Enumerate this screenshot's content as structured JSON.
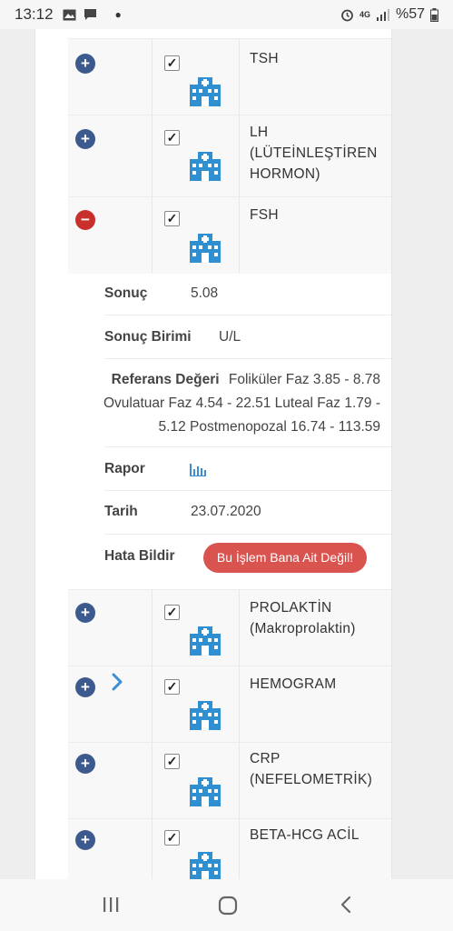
{
  "status_bar": {
    "time": "13:12",
    "battery": "%57",
    "network": "4G"
  },
  "tests": [
    {
      "name": "TSH",
      "expanded": false
    },
    {
      "name": "LH (LÜTEİNLEŞTİREN HORMON)",
      "expanded": false
    },
    {
      "name": "FSH",
      "expanded": true
    },
    {
      "name": "PROLAKTİN (Makroprolaktin)",
      "expanded": false
    },
    {
      "name": "HEMOGRAM",
      "expanded": false
    },
    {
      "name": "CRP (NEFELOMETRİK)",
      "expanded": false
    },
    {
      "name": "BETA-HCG ACİL",
      "expanded": false
    }
  ],
  "detail": {
    "result_label": "Sonuç",
    "result_value": "5.08",
    "unit_label": "Sonuç Birimi",
    "unit_value": "U/L",
    "ref_label": "Referans Değeri",
    "ref_value": "Foliküler Faz 3.85 - 8.78 Ovulatuar Faz 4.54 - 22.51 Luteal Faz 1.79 - 5.12 Postmenopozal 16.74 - 113.59",
    "report_label": "Rapor",
    "report_icon": "bar-chart-icon",
    "date_label": "Tarih",
    "date_value": "23.07.2020",
    "error_label": "Hata Bildir",
    "error_button": "Bu İşlem Bana Ait Değil!"
  },
  "colors": {
    "plus": "#3d5a8f",
    "minus": "#c9302c",
    "hospital_icon": "#2f8fd0",
    "error_button": "#d9534f",
    "chevron": "#3a8fd6"
  }
}
